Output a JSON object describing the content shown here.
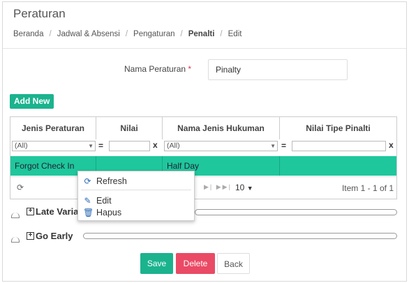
{
  "page": {
    "title": "Peraturan"
  },
  "breadcrumb": [
    "Beranda",
    "Jadwal & Absensi",
    "Pengaturan",
    "Penalti",
    "Edit"
  ],
  "form": {
    "name_label": "Nama Peraturan",
    "required_mark": "*",
    "name_value": "Pinalty"
  },
  "toolbar": {
    "add_label": "Add New"
  },
  "grid": {
    "columns": [
      "Jenis Peraturan",
      "Nilai",
      "Nama Jenis Hukuman",
      "Nilai Tipe Pinalti"
    ],
    "filter_all": "(All)",
    "filter_eq": "=",
    "filter_clear": "x",
    "rows": [
      {
        "jenis": "Forgot Check In",
        "nilai": "",
        "hukuman": "Half Day",
        "tipe": ""
      }
    ],
    "pager": {
      "page_size": "10",
      "info": "Item 1 - 1 of 1"
    }
  },
  "context_menu": {
    "refresh": "Refresh",
    "edit": "Edit",
    "delete": "Hapus"
  },
  "sections": [
    {
      "title": "Late Varia"
    },
    {
      "title": "Go Early"
    }
  ],
  "actions": {
    "save": "Save",
    "delete": "Delete",
    "back": "Back"
  },
  "colors": {
    "accent": "#1bb38e",
    "selected_row": "#1fc79d",
    "danger": "#ea4a65"
  }
}
